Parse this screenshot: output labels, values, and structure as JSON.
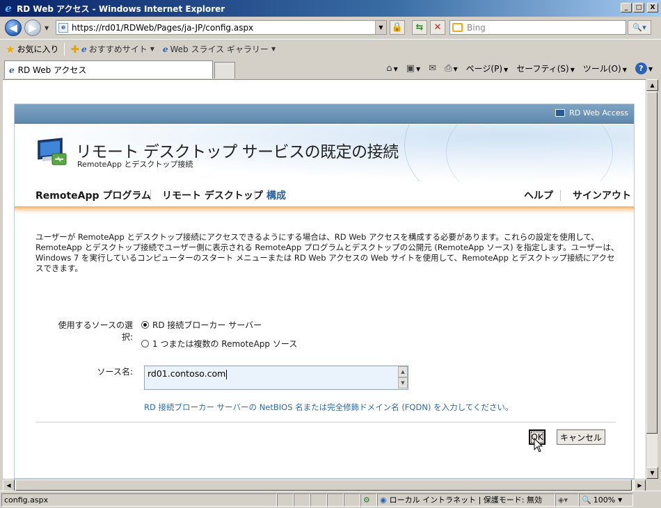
{
  "window": {
    "title": "RD Web アクセス - Windows Internet Explorer",
    "min_label": "_",
    "max_label": "□",
    "close_label": "X"
  },
  "toolbar": {
    "address": "https://rd01/RDWeb/Pages/ja-JP/config.aspx",
    "search_placeholder": "Bing"
  },
  "favorites": {
    "label": "お気に入り",
    "items": [
      "おすすめサイト",
      "Web スライス ギャラリー"
    ]
  },
  "tab": {
    "label": "RD Web アクセス"
  },
  "command_bar": {
    "page": "ページ(P)",
    "safety": "セーフティ(S)",
    "tools": "ツール(O)"
  },
  "rdweb": {
    "brand": "RD Web Access",
    "title": "リモート デスクトップ サービスの既定の接続",
    "subtitle": "RemoteApp とデスクトップ接続",
    "nav": {
      "remoteapp": "RemoteApp プログラム",
      "remote_desktop": "リモート デスクトップ",
      "config": "構成",
      "help": "ヘルプ",
      "signout": "サインアウト"
    },
    "description": "ユーザーが RemoteApp とデスクトップ接続にアクセスできるようにする場合は、RD Web アクセスを構成する必要があります。これらの設定を使用して、RemoteApp とデスクトップ接続でユーザー側に表示される RemoteApp プログラムとデスクトップの公開元 (RemoteApp ソース) を指定します。ユーザーは、Windows 7 を実行しているコンピューターのスタート メニューまたは RD Web アクセスの Web サイトを使用して、RemoteApp とデスクトップ接続にアクセスできます。",
    "form": {
      "source_select_label": "使用するソースの選択:",
      "option_broker": "RD 接続ブローカー サーバー",
      "option_sources": "1 つまたは複数の RemoteApp ソース",
      "selected_option": "RD 接続ブローカー サーバー",
      "source_name_label": "ソース名:",
      "source_name_value": "rd01.contoso.com",
      "hint": "RD 接続ブローカー サーバーの NetBIOS 名または完全修飾ドメイン名 (FQDN) を入力してください。",
      "ok_label": "OK",
      "cancel_label": "キャンセル"
    }
  },
  "status": {
    "url": "config.aspx",
    "zone": "ローカル イントラネット | 保護モード: 無効",
    "zoom": "100%"
  },
  "icons": {
    "back": "back-arrow-icon",
    "forward": "forward-arrow-icon",
    "refresh": "refresh-icon",
    "stop": "stop-icon",
    "lock": "lock-icon",
    "home": "home-icon",
    "rss": "rss-icon",
    "mail": "mail-icon",
    "print": "print-icon",
    "help": "help-icon"
  }
}
